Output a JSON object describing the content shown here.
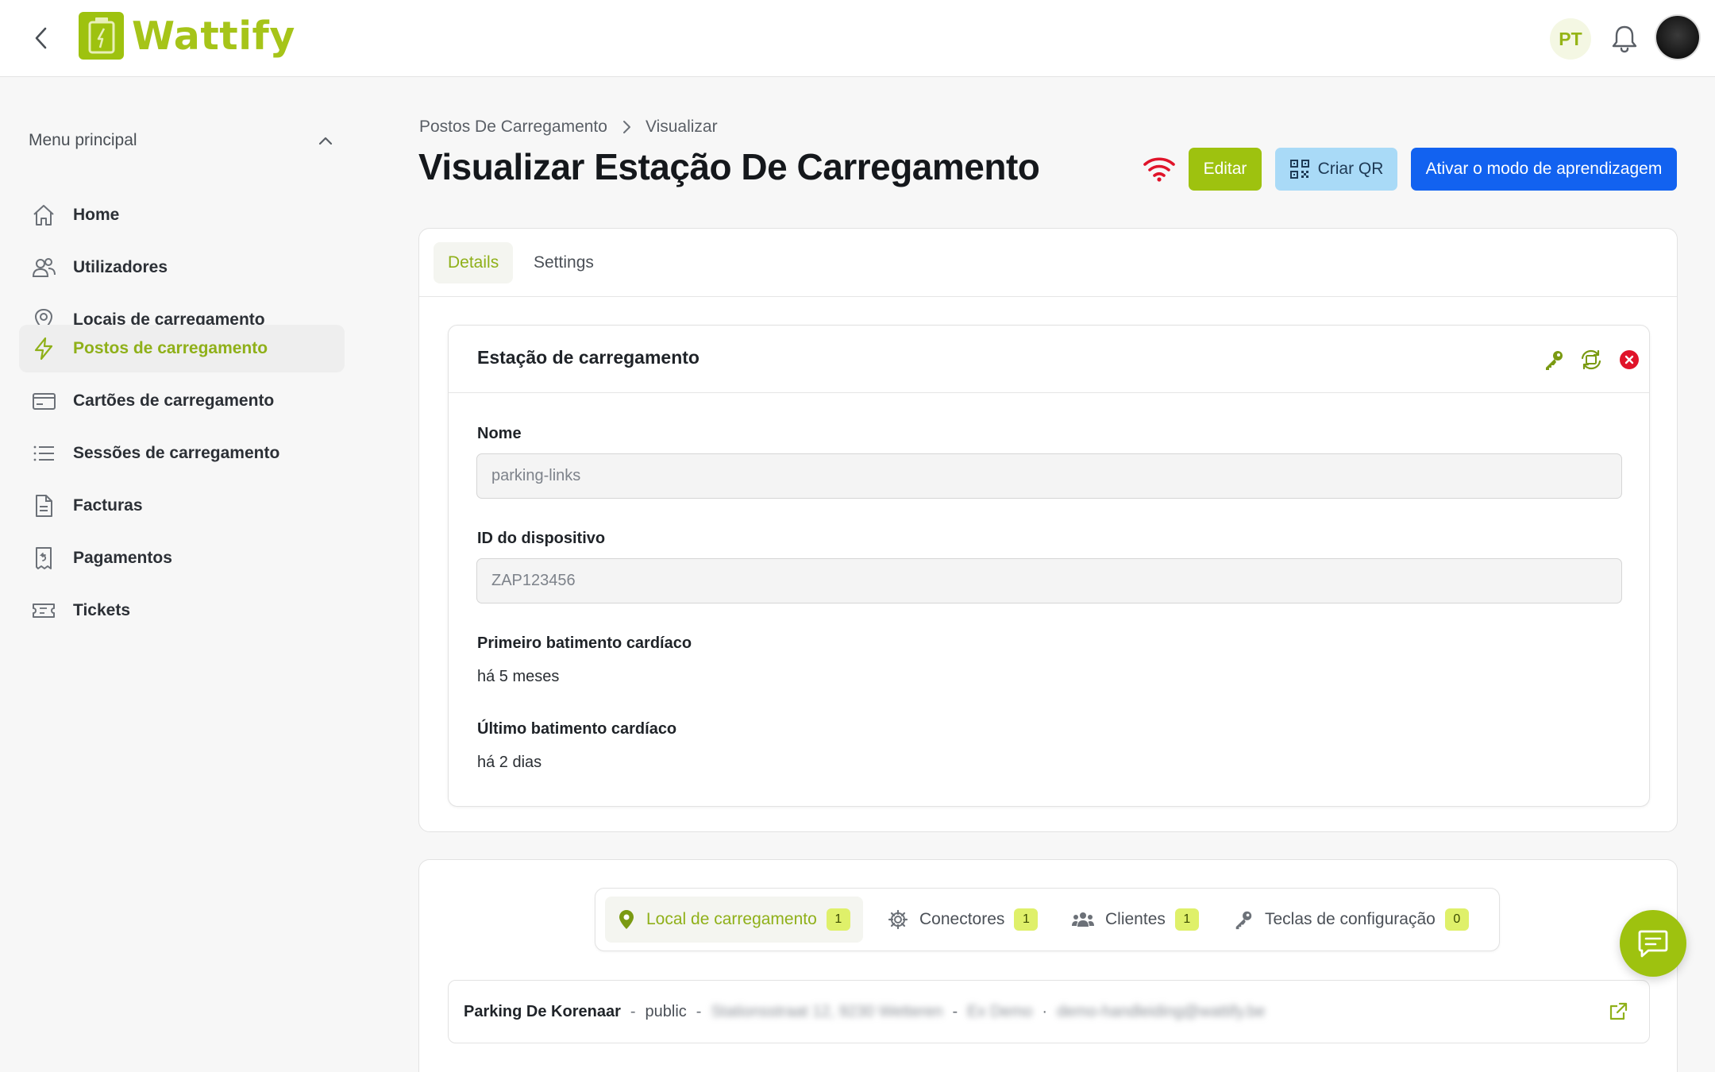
{
  "header": {
    "brand": "Wattify",
    "language": "PT",
    "icons": {
      "back": "chevron-left-icon",
      "notifications": "bell-icon",
      "logo": "battery-logo-icon"
    }
  },
  "sidebar": {
    "menu_title": "Menu principal",
    "items": [
      {
        "label": "Home",
        "icon": "home-icon",
        "active": false
      },
      {
        "label": "Utilizadores",
        "icon": "users-icon",
        "active": false
      },
      {
        "label": "Locais de carregamento",
        "icon": "map-pin-icon",
        "active": false
      },
      {
        "label": "Postos de carregamento",
        "icon": "lightning-icon",
        "active": true
      },
      {
        "label": "Cartões de carregamento",
        "icon": "card-icon",
        "active": false
      },
      {
        "label": "Sessões de carregamento",
        "icon": "list-icon",
        "active": false
      },
      {
        "label": "Facturas",
        "icon": "document-icon",
        "active": false
      },
      {
        "label": "Pagamentos",
        "icon": "receipt-icon",
        "active": false
      },
      {
        "label": "Tickets",
        "icon": "ticket-icon",
        "active": false
      }
    ]
  },
  "breadcrumb": {
    "parent": "Postos De Carregamento",
    "current": "Visualizar"
  },
  "page": {
    "title": "Visualizar Estação De Carregamento",
    "actions": {
      "edit": "Editar",
      "qr": "Criar QR",
      "learn": "Ativar o modo de aprendizagem"
    },
    "status_icon": "wifi-icon"
  },
  "tabs": [
    {
      "label": "Details",
      "active": true
    },
    {
      "label": "Settings",
      "active": false
    }
  ],
  "station": {
    "section_title": "Estação de carregamento",
    "name_label": "Nome",
    "name_value": "parking-links",
    "device_label": "ID do dispositivo",
    "device_value": "ZAP123456",
    "first_heartbeat_label": "Primeiro batimento cardíaco",
    "first_heartbeat_value": "há 5 meses",
    "last_heartbeat_label": "Último batimento cardíaco",
    "last_heartbeat_value": "há 2 dias"
  },
  "related_tabs": [
    {
      "label": "Local de carregamento",
      "count": "1",
      "icon": "map-pin-icon",
      "active": true
    },
    {
      "label": "Conectores",
      "count": "1",
      "icon": "gear-icon",
      "active": false
    },
    {
      "label": "Clientes",
      "count": "1",
      "icon": "users-icon",
      "active": false
    },
    {
      "label": "Teclas de configuração",
      "count": "0",
      "icon": "key-icon",
      "active": false
    }
  ],
  "site": {
    "name": "Parking De Korenaar",
    "type": "public",
    "address": "Stationsstraat 12, 9230 Wetteren",
    "contact": "Ex Demo",
    "email": "demo-handleiding@wattify.be"
  },
  "colors": {
    "accent": "#9ec20f",
    "primary": "#1262f0",
    "danger": "#e0142a"
  }
}
